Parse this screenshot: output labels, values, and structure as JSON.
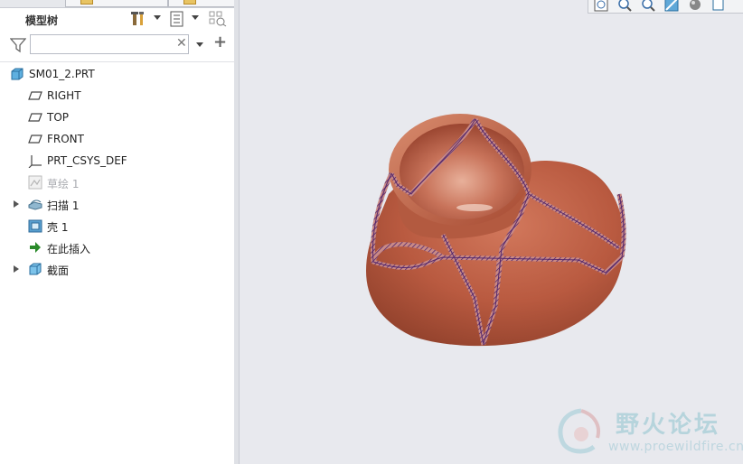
{
  "model_tree": {
    "title": "模型树",
    "search": {
      "value": "",
      "placeholder": ""
    },
    "items": [
      {
        "label": "SM01_2.PRT",
        "icon": "part-icon"
      },
      {
        "label": "RIGHT",
        "icon": "datum-plane-icon"
      },
      {
        "label": "TOP",
        "icon": "datum-plane-icon"
      },
      {
        "label": "FRONT",
        "icon": "datum-plane-icon"
      },
      {
        "label": "PRT_CSYS_DEF",
        "icon": "csys-icon"
      },
      {
        "label": "草绘 1",
        "icon": "sketch-icon",
        "state": "suppressed"
      },
      {
        "label": "扫描 1",
        "icon": "sweep-icon",
        "expandable": true
      },
      {
        "label": "壳 1",
        "icon": "shell-icon"
      },
      {
        "label": "在此插入",
        "icon": "insert-here-arrow-icon"
      },
      {
        "label": "截面",
        "icon": "section-icon",
        "expandable": true
      }
    ]
  },
  "watermark": {
    "title": "野火论坛",
    "url": "www.proewildfire.cn"
  },
  "colors": {
    "model_body": "#b95a40",
    "section_outline": "#5a2a7a",
    "background": "#e8e9ee",
    "insert_arrow": "#2a8a2a"
  }
}
